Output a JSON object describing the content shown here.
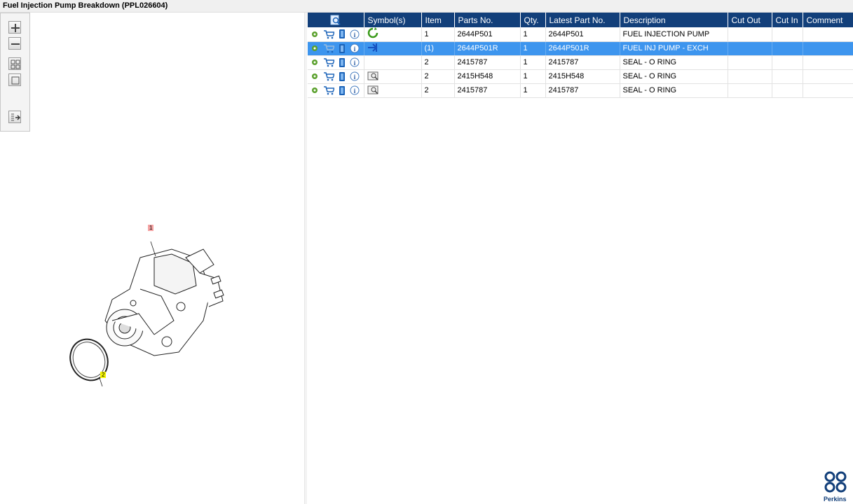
{
  "window": {
    "title": "Fuel Injection Pump Breakdown (PPL026604)"
  },
  "toolbar": {
    "zoom_in": "zoom-in-icon",
    "zoom_out": "zoom-out-icon",
    "fit_grid": "grid-view-icon",
    "fit_page": "fit-page-icon",
    "toggle_panel": "toggle-panel-icon"
  },
  "drawing": {
    "callouts": [
      "1",
      "2"
    ]
  },
  "table": {
    "columns": [
      "",
      "Symbol(s)",
      "Item",
      "Parts No.",
      "Qty.",
      "Latest Part No.",
      "Description",
      "Cut Out",
      "Cut In",
      "Comment"
    ],
    "rows": [
      {
        "item": "1",
        "parts_no": "2644P501",
        "qty": "1",
        "latest": "2644P501",
        "description": "FUEL INJECTION PUMP",
        "cut_out": "",
        "cut_in": "",
        "comment": "",
        "symbol": "recycle-icon",
        "selected": false
      },
      {
        "item": "(1)",
        "parts_no": "2644P501R",
        "qty": "1",
        "latest": "2644P501R",
        "description": "FUEL INJ PUMP - EXCH",
        "cut_out": "",
        "cut_in": "",
        "comment": "",
        "symbol": "exchange-icon",
        "selected": true
      },
      {
        "item": "2",
        "parts_no": "2415787",
        "qty": "1",
        "latest": "2415787",
        "description": "SEAL - O RING",
        "cut_out": "",
        "cut_in": "",
        "comment": "",
        "symbol": "",
        "selected": false
      },
      {
        "item": "2",
        "parts_no": "2415H548",
        "qty": "1",
        "latest": "2415H548",
        "description": "SEAL - O RING",
        "cut_out": "",
        "cut_in": "",
        "comment": "",
        "symbol": "kit-icon",
        "selected": false
      },
      {
        "item": "2",
        "parts_no": "2415787",
        "qty": "1",
        "latest": "2415787",
        "description": "SEAL - O RING",
        "cut_out": "",
        "cut_in": "",
        "comment": "",
        "symbol": "kit-icon",
        "selected": false
      }
    ]
  },
  "brand": {
    "name": "Perkins",
    "color": "#123f7a"
  },
  "colors": {
    "header": "#123f7a",
    "selected_row": "#3d95ee"
  }
}
